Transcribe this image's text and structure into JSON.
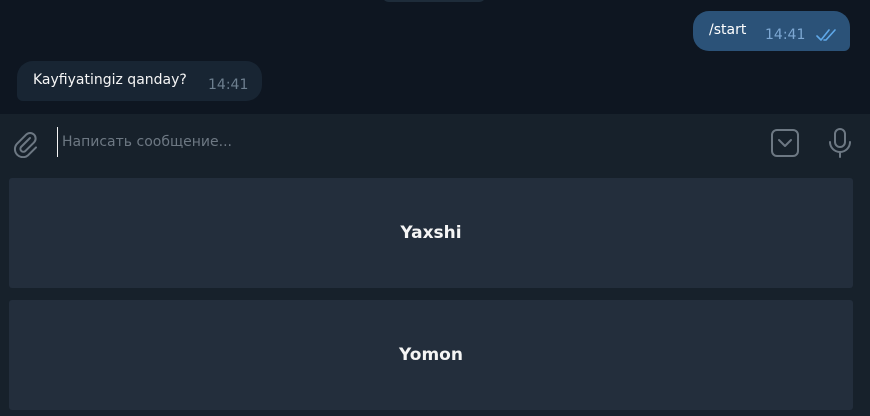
{
  "messages": {
    "outgoing": {
      "text": "/start",
      "time": "14:41"
    },
    "incoming": {
      "text": "Kayfiyatingiz qanday?",
      "time": "14:41"
    }
  },
  "composer": {
    "placeholder": "Написать сообщение...",
    "value": ""
  },
  "keyboard": {
    "buttons": [
      {
        "label": "Yaxshi"
      },
      {
        "label": "Yomon"
      }
    ]
  },
  "colors": {
    "background": "#0e1621",
    "panel": "#17212b",
    "outgoing_bubble": "#2b5278",
    "incoming_bubble": "#182533",
    "keyboard_button": "#232e3c",
    "check_accent": "#5fa8e8"
  },
  "icons": [
    "paperclip-icon",
    "double-check-icon",
    "bot-keyboard-icon",
    "microphone-icon"
  ]
}
